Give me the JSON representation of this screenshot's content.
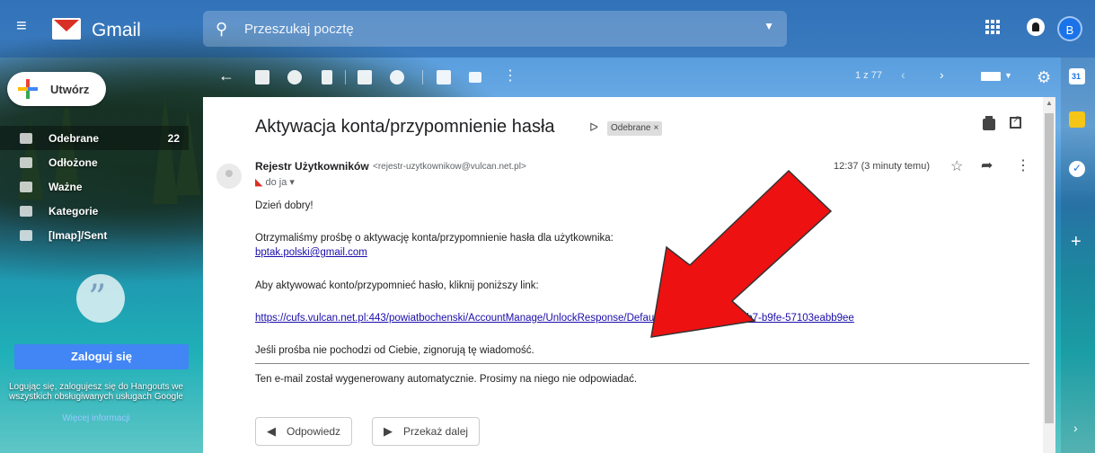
{
  "app": {
    "name": "Gmail"
  },
  "search": {
    "placeholder": "Przeszukaj pocztę"
  },
  "account": {
    "initial": "B"
  },
  "compose": {
    "label": "Utwórz"
  },
  "sidebar": {
    "items": [
      {
        "label": "Odebrane",
        "count": "22",
        "active": true
      },
      {
        "label": "Odłożone",
        "count": ""
      },
      {
        "label": "Ważne",
        "count": ""
      },
      {
        "label": "Kategorie",
        "count": ""
      },
      {
        "label": "[Imap]/Sent",
        "count": ""
      }
    ]
  },
  "hangouts": {
    "signin_label": "Zaloguj się",
    "description": "Logując się, zalogujesz się do Hangouts we wszystkich obsługiwanych usługach Google",
    "more_info": "Więcej informacji"
  },
  "toolbar": {
    "pager": "1 z 77"
  },
  "message": {
    "subject": "Aktywacja konta/przypomnienie hasła",
    "label": "Odebrane",
    "sender_name": "Rejestr Użytkowników",
    "sender_email": "<rejestr-uzytkownikow@vulcan.net.pl>",
    "to": "do ja",
    "time": "12:37 (3 minuty temu)",
    "body": {
      "greeting": "Dzień dobry!",
      "line1": "Otrzymaliśmy prośbę o aktywację konta/przypomnienie hasła dla użytkownika:",
      "user_email": "bptak.polski@gmail.com",
      "line2": "Aby aktywować konto/przypomnieć hasło, kliknij poniższy link:",
      "activation_link": "https://cufs.vulcan.net.pl:443/powiatbochenski/AccountManage/UnlockResponse/Default/444e3760-1f7b-4ab7-b9fe-57103eabb9ee",
      "line3": "Jeśli prośba nie pochodzi od Ciebie, zignorują tę wiadomość.",
      "footer": "Ten e-mail został wygenerowany automatycznie. Prosimy na niego nie odpowiadać."
    },
    "reply_label": "Odpowiedz",
    "forward_label": "Przekaż dalej"
  },
  "colors": {
    "annotation_arrow": "#ee1111",
    "link": "#1a0dab",
    "signin": "#4285f4"
  }
}
